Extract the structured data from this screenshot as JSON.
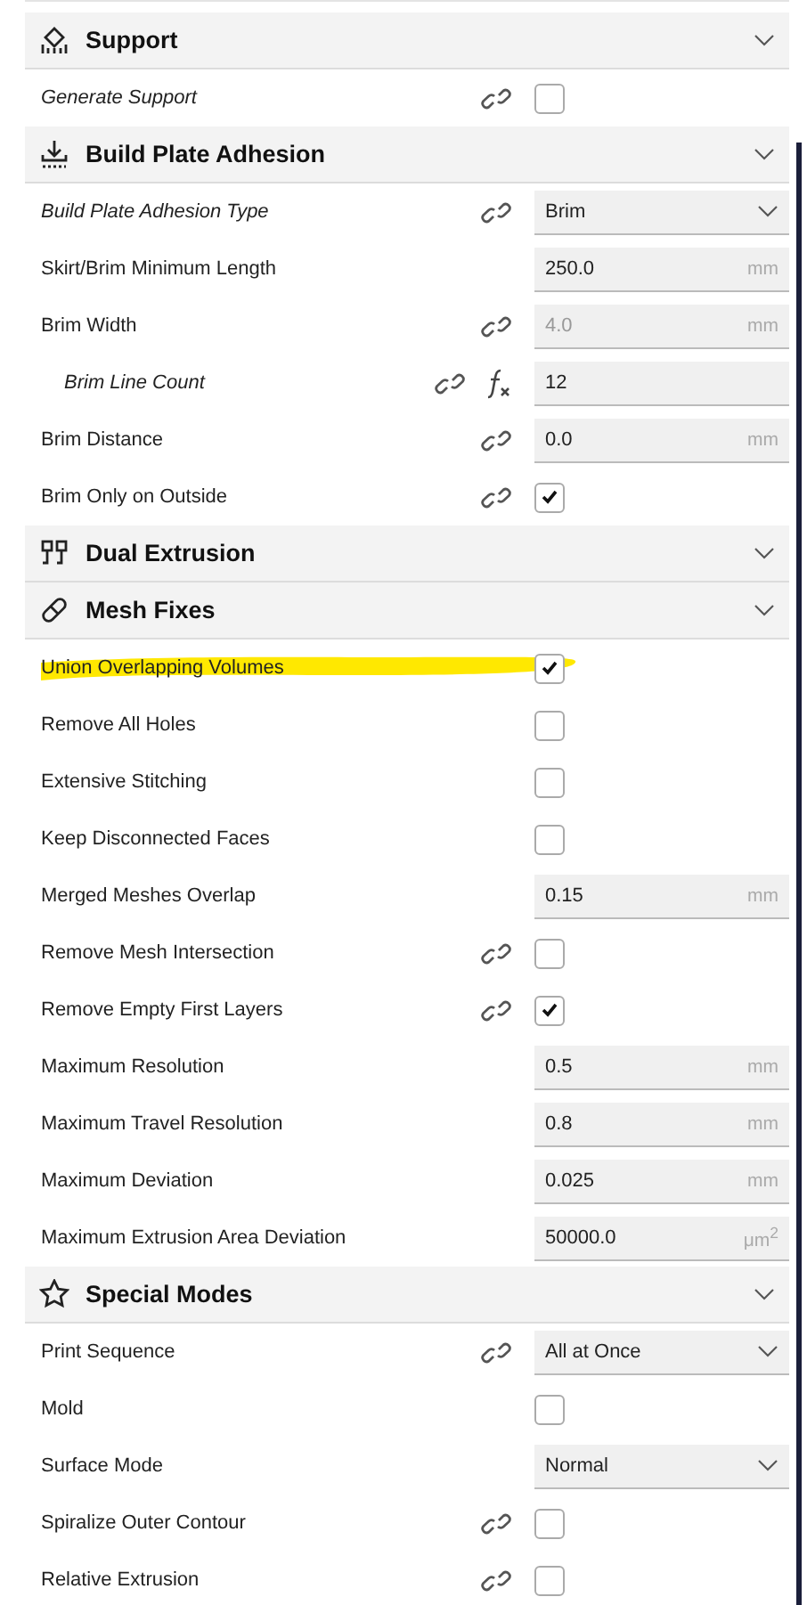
{
  "sections": [
    {
      "title": "Support",
      "settings": [
        {
          "kind": "checkbox",
          "label": "Generate Support",
          "italic": true,
          "linked": true,
          "checked": false
        }
      ]
    },
    {
      "title": "Build Plate Adhesion",
      "settings": [
        {
          "kind": "dropdown",
          "label": "Build Plate Adhesion Type",
          "italic": true,
          "linked": true,
          "value": "Brim"
        },
        {
          "kind": "number",
          "label": "Skirt/Brim Minimum Length",
          "linked": false,
          "value": "250.0",
          "unit": "mm"
        },
        {
          "kind": "number",
          "label": "Brim Width",
          "linked": true,
          "disabled": true,
          "value": "4.0",
          "unit": "mm",
          "children": [
            {
              "kind": "number",
              "label": "Brim Line Count",
              "italic": true,
              "linked": true,
              "formula": true,
              "value": "12"
            }
          ]
        },
        {
          "kind": "number",
          "label": "Brim Distance",
          "linked": true,
          "value": "0.0",
          "unit": "mm"
        },
        {
          "kind": "checkbox",
          "label": "Brim Only on Outside",
          "linked": true,
          "checked": true
        }
      ]
    },
    {
      "title": "Dual Extrusion"
    },
    {
      "title": "Mesh Fixes",
      "settings": [
        {
          "kind": "checkbox",
          "label": "Union Overlapping Volumes",
          "linked": false,
          "checked": true,
          "highlighted": true
        },
        {
          "kind": "checkbox",
          "label": "Remove All Holes",
          "linked": false,
          "checked": false
        },
        {
          "kind": "checkbox",
          "label": "Extensive Stitching",
          "linked": false,
          "checked": false
        },
        {
          "kind": "checkbox",
          "label": "Keep Disconnected Faces",
          "linked": false,
          "checked": false
        },
        {
          "kind": "number",
          "label": "Merged Meshes Overlap",
          "linked": false,
          "value": "0.15",
          "unit": "mm"
        },
        {
          "kind": "checkbox",
          "label": "Remove Mesh Intersection",
          "linked": true,
          "checked": false
        },
        {
          "kind": "checkbox",
          "label": "Remove Empty First Layers",
          "linked": true,
          "checked": true
        },
        {
          "kind": "number",
          "label": "Maximum Resolution",
          "linked": false,
          "value": "0.5",
          "unit": "mm"
        },
        {
          "kind": "number",
          "label": "Maximum Travel Resolution",
          "linked": false,
          "value": "0.8",
          "unit": "mm"
        },
        {
          "kind": "number",
          "label": "Maximum Deviation",
          "linked": false,
          "value": "0.025",
          "unit": "mm"
        },
        {
          "kind": "number",
          "label": "Maximum Extrusion Area Deviation",
          "linked": false,
          "value": "50000.0",
          "unit": "μm$^{2}$"
        }
      ]
    },
    {
      "title": "Special Modes",
      "settings": [
        {
          "kind": "dropdown",
          "label": "Print Sequence",
          "linked": true,
          "value": "All at Once"
        },
        {
          "kind": "checkbox",
          "label": "Mold",
          "linked": false,
          "checked": false
        },
        {
          "kind": "dropdown",
          "label": "Surface Mode",
          "linked": false,
          "value": "Normal"
        },
        {
          "kind": "checkbox",
          "label": "Spiralize Outer Contour",
          "linked": true,
          "checked": false
        },
        {
          "kind": "checkbox",
          "label": "Relative Extrusion",
          "linked": true,
          "checked": false
        }
      ]
    }
  ]
}
